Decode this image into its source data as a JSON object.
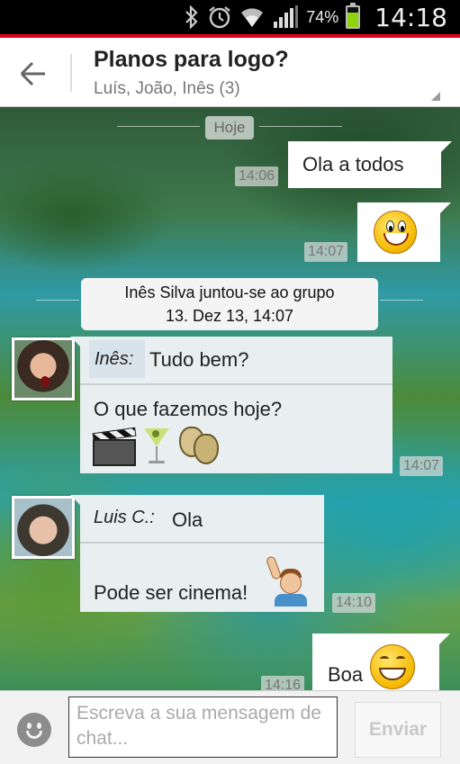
{
  "status_bar": {
    "icons": [
      "bluetooth-icon",
      "alarm-icon",
      "wifi-icon",
      "signal-icon",
      "battery-icon"
    ],
    "battery_percent": "74%",
    "battery_level": 0.74,
    "battery_color": "#8fd20e",
    "time": "14:18",
    "accent_line_color": "#e2001a"
  },
  "header": {
    "title": "Planos para logo?",
    "subtitle": "Luís, João, Inês (3)"
  },
  "chat": {
    "date_separator": "Hoje",
    "messages": [
      {
        "type": "outgoing",
        "text": "Ola a todos",
        "time": "14:06"
      },
      {
        "type": "outgoing",
        "emoji": "smiley-emoji",
        "time": "14:07"
      },
      {
        "type": "system",
        "line1": "Inês Silva juntou-se ao grupo",
        "line2": "13. Dez 13, 14:07"
      },
      {
        "type": "incoming",
        "sender": "Inês:",
        "text": "Tudo bem?",
        "text2": "O que fazemos hoje?",
        "emojis": [
          "clapperboard-emoji",
          "cocktail-emoji",
          "theater-masks-emoji"
        ],
        "time": "14:07"
      },
      {
        "type": "incoming",
        "sender": "Luis C.:",
        "text": "Ola",
        "text2": "Pode ser cinema!",
        "emojis": [
          "person-raising-hand-emoji"
        ],
        "time": "14:10"
      },
      {
        "type": "outgoing",
        "text": "Boa",
        "emoji": "grinning-emoji",
        "time": "14:16"
      }
    ]
  },
  "input_bar": {
    "placeholder": "Escreva a sua mensagem de chat...",
    "send_label": "Enviar",
    "emoji_button_icon": "smiley-face-icon"
  }
}
